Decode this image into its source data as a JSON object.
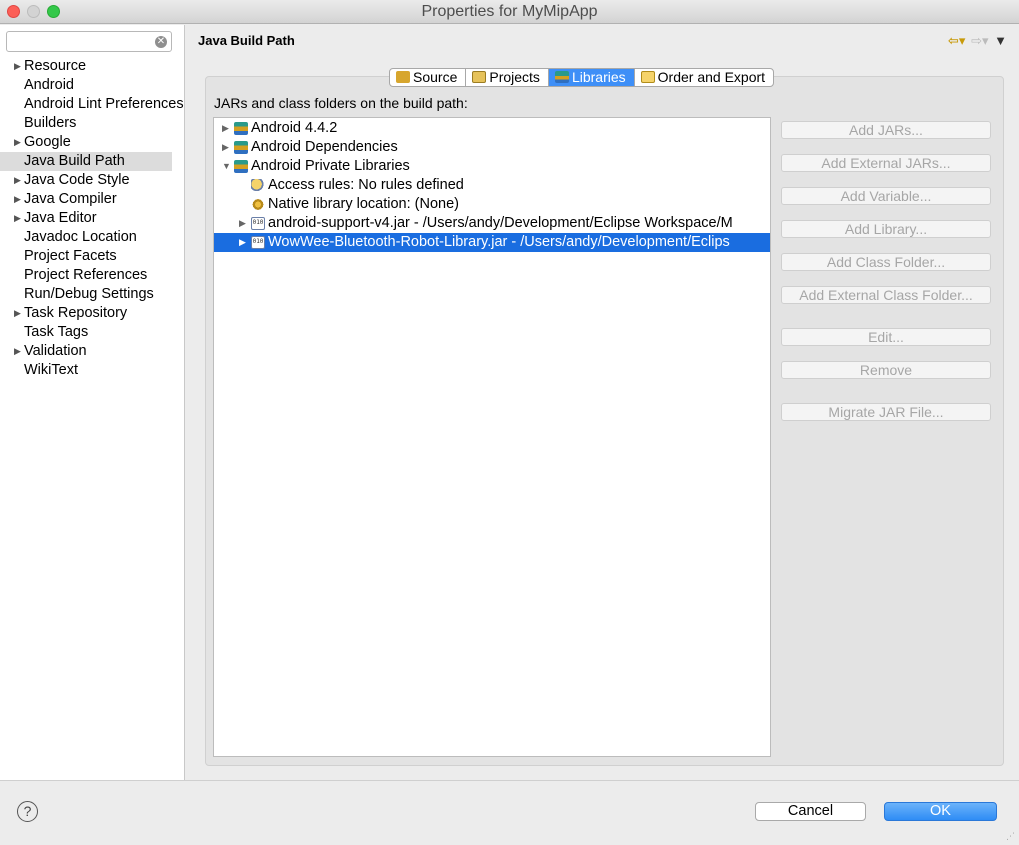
{
  "window": {
    "title": "Properties for MyMipApp"
  },
  "sidebar": {
    "filter_value": "",
    "items": [
      {
        "label": "Resource",
        "expandable": true
      },
      {
        "label": "Android",
        "expandable": false
      },
      {
        "label": "Android Lint Preferences",
        "expandable": false
      },
      {
        "label": "Builders",
        "expandable": false
      },
      {
        "label": "Google",
        "expandable": true
      },
      {
        "label": "Java Build Path",
        "expandable": false,
        "selected": true
      },
      {
        "label": "Java Code Style",
        "expandable": true
      },
      {
        "label": "Java Compiler",
        "expandable": true
      },
      {
        "label": "Java Editor",
        "expandable": true
      },
      {
        "label": "Javadoc Location",
        "expandable": false
      },
      {
        "label": "Project Facets",
        "expandable": false
      },
      {
        "label": "Project References",
        "expandable": false
      },
      {
        "label": "Run/Debug Settings",
        "expandable": false
      },
      {
        "label": "Task Repository",
        "expandable": true
      },
      {
        "label": "Task Tags",
        "expandable": false
      },
      {
        "label": "Validation",
        "expandable": true
      },
      {
        "label": "WikiText",
        "expandable": false
      }
    ]
  },
  "page": {
    "title": "Java Build Path",
    "tabs": [
      {
        "label": "Source",
        "icon": "source-folder-icon"
      },
      {
        "label": "Projects",
        "icon": "projects-icon"
      },
      {
        "label": "Libraries",
        "icon": "libraries-icon",
        "active": true
      },
      {
        "label": "Order and Export",
        "icon": "order-export-icon"
      }
    ],
    "section_label": "JARs and class folders on the build path:",
    "tree": [
      {
        "label": "Android 4.4.2",
        "level": 0,
        "expander": "collapsed",
        "icon": "library-icon"
      },
      {
        "label": "Android Dependencies",
        "level": 0,
        "expander": "collapsed",
        "icon": "library-icon"
      },
      {
        "label": "Android Private Libraries",
        "level": 0,
        "expander": "expanded",
        "icon": "library-icon"
      },
      {
        "label": "Access rules: No rules defined",
        "level": 1,
        "expander": "none",
        "icon": "access-rules-icon"
      },
      {
        "label": "Native library location: (None)",
        "level": 1,
        "expander": "none",
        "icon": "native-library-icon"
      },
      {
        "label": "android-support-v4.jar - /Users/andy/Development/Eclipse Workspace/M",
        "level": 1,
        "expander": "collapsed",
        "icon": "jar-icon"
      },
      {
        "label": "WowWee-Bluetooth-Robot-Library.jar - /Users/andy/Development/Eclips",
        "level": 1,
        "expander": "collapsed",
        "icon": "jar-icon",
        "selected": true
      }
    ],
    "buttons": {
      "add_jars": "Add JARs...",
      "add_external_jars": "Add External JARs...",
      "add_variable": "Add Variable...",
      "add_library": "Add Library...",
      "add_class_folder": "Add Class Folder...",
      "add_external_class_folder": "Add External Class Folder...",
      "edit": "Edit...",
      "remove": "Remove",
      "migrate_jar": "Migrate JAR File..."
    }
  },
  "footer": {
    "help": "?",
    "cancel": "Cancel",
    "ok": "OK"
  },
  "colors": {
    "selection": "#1a6de0",
    "tab_active": "#3e8ff7",
    "ok_button": "#2e8cf5"
  }
}
